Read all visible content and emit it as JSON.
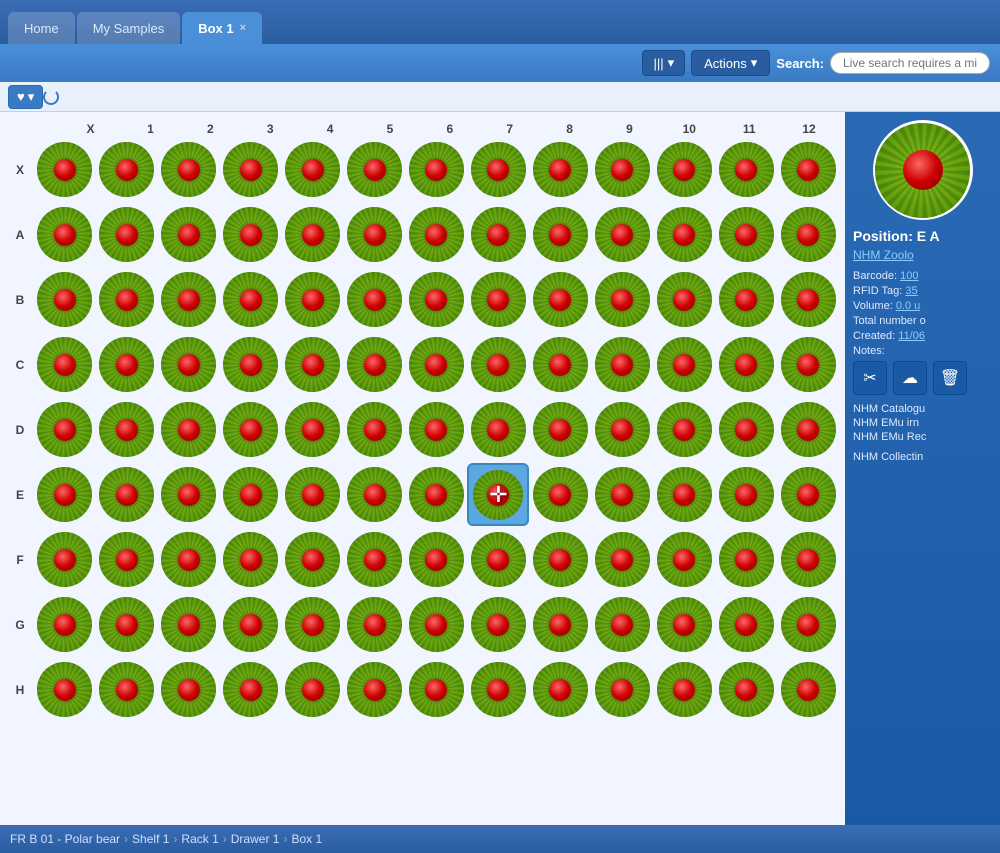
{
  "tabs": [
    {
      "id": "home",
      "label": "Home",
      "active": false,
      "closeable": false
    },
    {
      "id": "my-samples",
      "label": "My Samples",
      "active": false,
      "closeable": false
    },
    {
      "id": "box1",
      "label": "Box 1",
      "active": true,
      "closeable": true
    }
  ],
  "toolbar": {
    "barcode_label": "|||",
    "actions_label": "Actions",
    "actions_dropdown": "▾",
    "barcode_dropdown": "▾",
    "search_label": "Search:",
    "search_placeholder": "Live search requires a mi"
  },
  "fav_button": "♥",
  "fav_dropdown": "▾",
  "grid": {
    "col_headers": [
      "1",
      "2",
      "3",
      "4",
      "5",
      "6",
      "7",
      "8",
      "9",
      "10",
      "11",
      "12"
    ],
    "row_headers": [
      "X",
      "A",
      "B",
      "C",
      "D",
      "E",
      "F",
      "G",
      "H"
    ],
    "selected_cell": {
      "row": 5,
      "col": 7
    }
  },
  "side_panel": {
    "position": "Position: E A",
    "nhm_link": "NHM Zoolo",
    "barcode_label": "Barcode:",
    "barcode_value": "100",
    "rfid_label": "RFID Tag:",
    "rfid_value": "35",
    "volume_label": "Volume:",
    "volume_value": "0.0 u",
    "total_label": "Total number o",
    "created_label": "Created:",
    "created_value": "11/06",
    "notes_label": "Notes:",
    "action_icons": [
      "✂",
      "☁",
      "🗑"
    ],
    "catalogue_items": [
      "NHM Catalogu",
      "NHM EMu irn ",
      "NHM EMu Rec"
    ],
    "collecting_label": "NHM Collectin"
  },
  "breadcrumb": {
    "items": [
      "FR B 01 - Polar bear",
      "Shelf 1",
      "Rack 1",
      "Drawer 1",
      "Box 1"
    ]
  }
}
